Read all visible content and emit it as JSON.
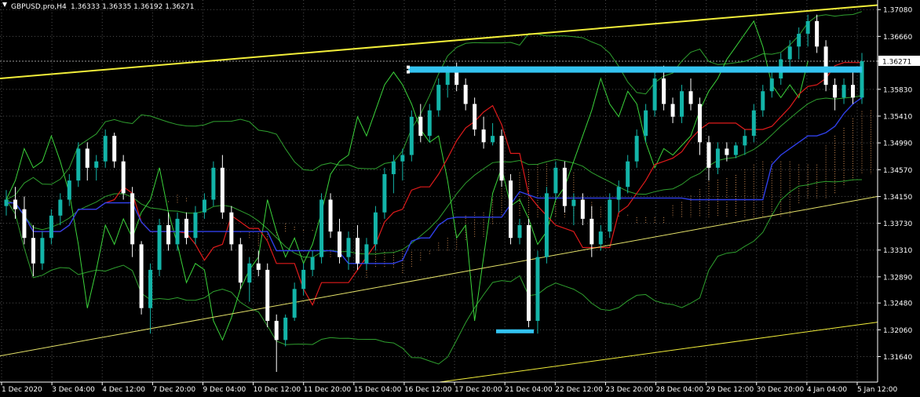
{
  "header": {
    "symbol": "GBPUSD.pro,H4",
    "ohlc": "1.36333 1.36335 1.36192 1.36271"
  },
  "colors": {
    "background": "#000000",
    "grid": "#4d4d4d",
    "bull_candle": "#13b4a8",
    "bear_candle": "#ffffff",
    "tenkan": "#e01b1b",
    "kijun": "#2f3fe8",
    "chikou": "#3bd43b",
    "bollinger": "#2fa02f",
    "kumo": "#f4a460",
    "trend_yellow": "#f2ee3a",
    "ma_yellow": "#e6e36a",
    "level_cyan": "#33c3f0"
  },
  "chart_data": {
    "type": "candlestick",
    "timeframe": "H4",
    "ylim": [
      1.3124,
      1.3723
    ],
    "y_ticks": [
      "1.37080",
      "1.36660",
      "1.36271",
      "1.35830",
      "1.35410",
      "1.34990",
      "1.34570",
      "1.34150",
      "1.33730",
      "1.33310",
      "1.32890",
      "1.32480",
      "1.32060",
      "1.31640"
    ],
    "current_price": "1.36271",
    "x_ticks": [
      "1 Dec 2020",
      "3 Dec 04:00",
      "4 Dec 12:00",
      "7 Dec 20:00",
      "9 Dec 04:00",
      "10 Dec 12:00",
      "11 Dec 20:00",
      "15 Dec 04:00",
      "16 Dec 12:00",
      "17 Dec 20:00",
      "21 Dec 04:00",
      "22 Dec 12:00",
      "23 Dec 20:00",
      "28 Dec 04:00",
      "29 Dec 12:00",
      "30 Dec 20:00",
      "4 Jan 04:00",
      "5 Jan 12:00"
    ],
    "candles_ohlc": [
      [
        1.34,
        1.3425,
        1.3385,
        1.341
      ],
      [
        1.341,
        1.343,
        1.338,
        1.3395
      ],
      [
        1.3395,
        1.3415,
        1.334,
        1.335
      ],
      [
        1.335,
        1.337,
        1.329,
        1.331
      ],
      [
        1.331,
        1.336,
        1.33,
        1.335
      ],
      [
        1.335,
        1.3395,
        1.334,
        1.3385
      ],
      [
        1.3385,
        1.342,
        1.337,
        1.341
      ],
      [
        1.341,
        1.345,
        1.34,
        1.344
      ],
      [
        1.344,
        1.35,
        1.343,
        1.349
      ],
      [
        1.349,
        1.35,
        1.344,
        1.346
      ],
      [
        1.346,
        1.348,
        1.344,
        1.347
      ],
      [
        1.347,
        1.352,
        1.346,
        1.351
      ],
      [
        1.351,
        1.3515,
        1.346,
        1.347
      ],
      [
        1.347,
        1.348,
        1.341,
        1.342
      ],
      [
        1.342,
        1.343,
        1.332,
        1.334
      ],
      [
        1.334,
        1.3345,
        1.323,
        1.324
      ],
      [
        1.324,
        1.331,
        1.32,
        1.33
      ],
      [
        1.33,
        1.338,
        1.329,
        1.337
      ],
      [
        1.337,
        1.339,
        1.333,
        1.334
      ],
      [
        1.334,
        1.339,
        1.333,
        1.338
      ],
      [
        1.338,
        1.339,
        1.334,
        1.335
      ],
      [
        1.335,
        1.34,
        1.334,
        1.339
      ],
      [
        1.339,
        1.342,
        1.338,
        1.341
      ],
      [
        1.341,
        1.347,
        1.34,
        1.346
      ],
      [
        1.346,
        1.348,
        1.338,
        1.339
      ],
      [
        1.339,
        1.34,
        1.333,
        1.334
      ],
      [
        1.334,
        1.335,
        1.327,
        1.328
      ],
      [
        1.328,
        1.332,
        1.325,
        1.331
      ],
      [
        1.331,
        1.333,
        1.329,
        1.33
      ],
      [
        1.33,
        1.331,
        1.321,
        1.322
      ],
      [
        1.322,
        1.323,
        1.314,
        1.319
      ],
      [
        1.319,
        1.323,
        1.318,
        1.3225
      ],
      [
        1.3225,
        1.328,
        1.322,
        1.327
      ],
      [
        1.327,
        1.331,
        1.326,
        1.33
      ],
      [
        1.33,
        1.333,
        1.329,
        1.332
      ],
      [
        1.332,
        1.342,
        1.331,
        1.341
      ],
      [
        1.341,
        1.342,
        1.335,
        1.336
      ],
      [
        1.336,
        1.338,
        1.331,
        1.332
      ],
      [
        1.332,
        1.336,
        1.33,
        1.335
      ],
      [
        1.335,
        1.337,
        1.33,
        1.331
      ],
      [
        1.331,
        1.335,
        1.33,
        1.334
      ],
      [
        1.334,
        1.34,
        1.333,
        1.339
      ],
      [
        1.339,
        1.346,
        1.338,
        1.345
      ],
      [
        1.345,
        1.348,
        1.342,
        1.347
      ],
      [
        1.347,
        1.349,
        1.344,
        1.348
      ],
      [
        1.348,
        1.355,
        1.347,
        1.354
      ],
      [
        1.354,
        1.356,
        1.35,
        1.351
      ],
      [
        1.351,
        1.356,
        1.35,
        1.355
      ],
      [
        1.355,
        1.36,
        1.354,
        1.359
      ],
      [
        1.359,
        1.362,
        1.357,
        1.361
      ],
      [
        1.361,
        1.3625,
        1.358,
        1.359
      ],
      [
        1.359,
        1.36,
        1.355,
        1.356
      ],
      [
        1.356,
        1.357,
        1.351,
        1.352
      ],
      [
        1.352,
        1.354,
        1.349,
        1.35
      ],
      [
        1.35,
        1.353,
        1.3495,
        1.351
      ],
      [
        1.351,
        1.352,
        1.343,
        1.344
      ],
      [
        1.344,
        1.345,
        1.334,
        1.335
      ],
      [
        1.335,
        1.338,
        1.334,
        1.337
      ],
      [
        1.337,
        1.338,
        1.321,
        1.322
      ],
      [
        1.322,
        1.333,
        1.32,
        1.332
      ],
      [
        1.332,
        1.343,
        1.331,
        1.342
      ],
      [
        1.342,
        1.347,
        1.341,
        1.346
      ],
      [
        1.346,
        1.347,
        1.339,
        1.34
      ],
      [
        1.34,
        1.342,
        1.337,
        1.341
      ],
      [
        1.341,
        1.342,
        1.337,
        1.338
      ],
      [
        1.338,
        1.34,
        1.332,
        1.334
      ],
      [
        1.334,
        1.337,
        1.333,
        1.336
      ],
      [
        1.336,
        1.342,
        1.335,
        1.341
      ],
      [
        1.341,
        1.344,
        1.339,
        1.343
      ],
      [
        1.343,
        1.348,
        1.342,
        1.347
      ],
      [
        1.347,
        1.352,
        1.346,
        1.351
      ],
      [
        1.351,
        1.356,
        1.35,
        1.355
      ],
      [
        1.355,
        1.361,
        1.354,
        1.36
      ],
      [
        1.36,
        1.362,
        1.355,
        1.356
      ],
      [
        1.356,
        1.357,
        1.353,
        1.354
      ],
      [
        1.354,
        1.359,
        1.353,
        1.358
      ],
      [
        1.358,
        1.36,
        1.355,
        1.356
      ],
      [
        1.356,
        1.357,
        1.348,
        1.35
      ],
      [
        1.35,
        1.351,
        1.344,
        1.346
      ],
      [
        1.346,
        1.35,
        1.345,
        1.349
      ],
      [
        1.349,
        1.35,
        1.347,
        1.348
      ],
      [
        1.348,
        1.35,
        1.3475,
        1.3495
      ],
      [
        1.3495,
        1.352,
        1.348,
        1.351
      ],
      [
        1.351,
        1.356,
        1.35,
        1.355
      ],
      [
        1.355,
        1.359,
        1.354,
        1.358
      ],
      [
        1.358,
        1.361,
        1.357,
        1.36
      ],
      [
        1.36,
        1.364,
        1.359,
        1.363
      ],
      [
        1.363,
        1.366,
        1.361,
        1.365
      ],
      [
        1.365,
        1.368,
        1.363,
        1.367
      ],
      [
        1.367,
        1.37,
        1.365,
        1.369
      ],
      [
        1.369,
        1.37,
        1.364,
        1.365
      ],
      [
        1.365,
        1.366,
        1.358,
        1.359
      ],
      [
        1.359,
        1.36,
        1.355,
        1.357
      ],
      [
        1.357,
        1.36,
        1.356,
        1.359
      ],
      [
        1.359,
        1.361,
        1.356,
        1.357
      ],
      [
        1.357,
        1.364,
        1.356,
        1.3627
      ]
    ],
    "horizontal_level": 1.3614,
    "support_marker": 1.3203,
    "indicators": [
      "Ichimoku Kinko Hyo",
      "Bollinger Bands",
      "Moving Average",
      "Trendlines"
    ]
  }
}
